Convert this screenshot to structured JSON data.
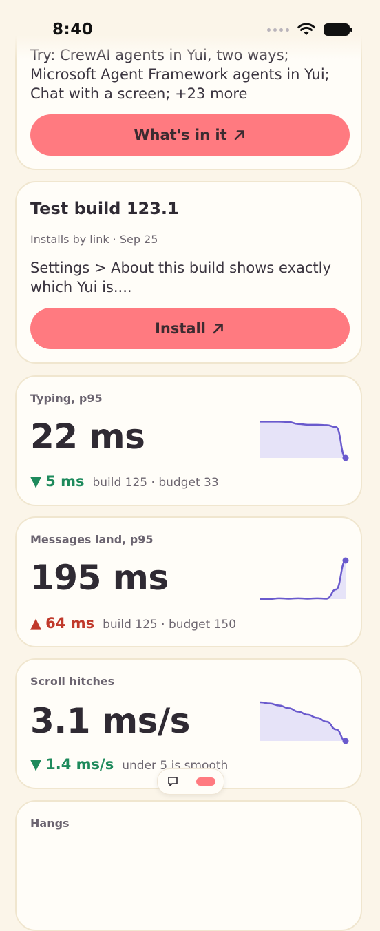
{
  "status_bar": {
    "time": "8:40"
  },
  "colors": {
    "background": "#fbf5e9",
    "accent": "#ff7a80",
    "good": "#1e8a5c",
    "bad": "#c0392b",
    "spark": "#6a5acd"
  },
  "cards": [
    {
      "desc": "Try: CrewAI agents in Yui, two ways; Microsoft Agent Framework agents in Yui; Chat with a screen; +23 more",
      "button": "What's in it"
    },
    {
      "title": "Test build 123.1",
      "meta": "Installs by link · Sep 25",
      "desc": "Settings > About this build shows exactly which Yui is....",
      "button": "Install"
    }
  ],
  "metrics": [
    {
      "label": "Typing, p95",
      "value": "22 ms",
      "delta": "5 ms",
      "direction": "down",
      "note": "build 125 · budget 33",
      "trend": [
        0.94,
        0.94,
        0.94,
        0.93,
        0.88,
        0.86,
        0.86,
        0.85,
        0.8,
        0.0
      ],
      "fill": true
    },
    {
      "label": "Messages land, p95",
      "value": "195 ms",
      "delta": "64 ms",
      "direction": "up",
      "note": "build 125 · budget 150",
      "trend": [
        0.0,
        0.0,
        0.02,
        0.01,
        0.02,
        0.01,
        0.02,
        0.01,
        0.25,
        1.0
      ],
      "fill": true
    },
    {
      "label": "Scroll hitches",
      "value": "3.1 ms/s",
      "delta": "1.4 ms/s",
      "direction": "down",
      "note": "under 5 is smooth",
      "trend": [
        1.0,
        0.97,
        0.92,
        0.85,
        0.76,
        0.68,
        0.6,
        0.5,
        0.3,
        0.0
      ],
      "fill": true
    },
    {
      "label": "Hangs"
    }
  ]
}
